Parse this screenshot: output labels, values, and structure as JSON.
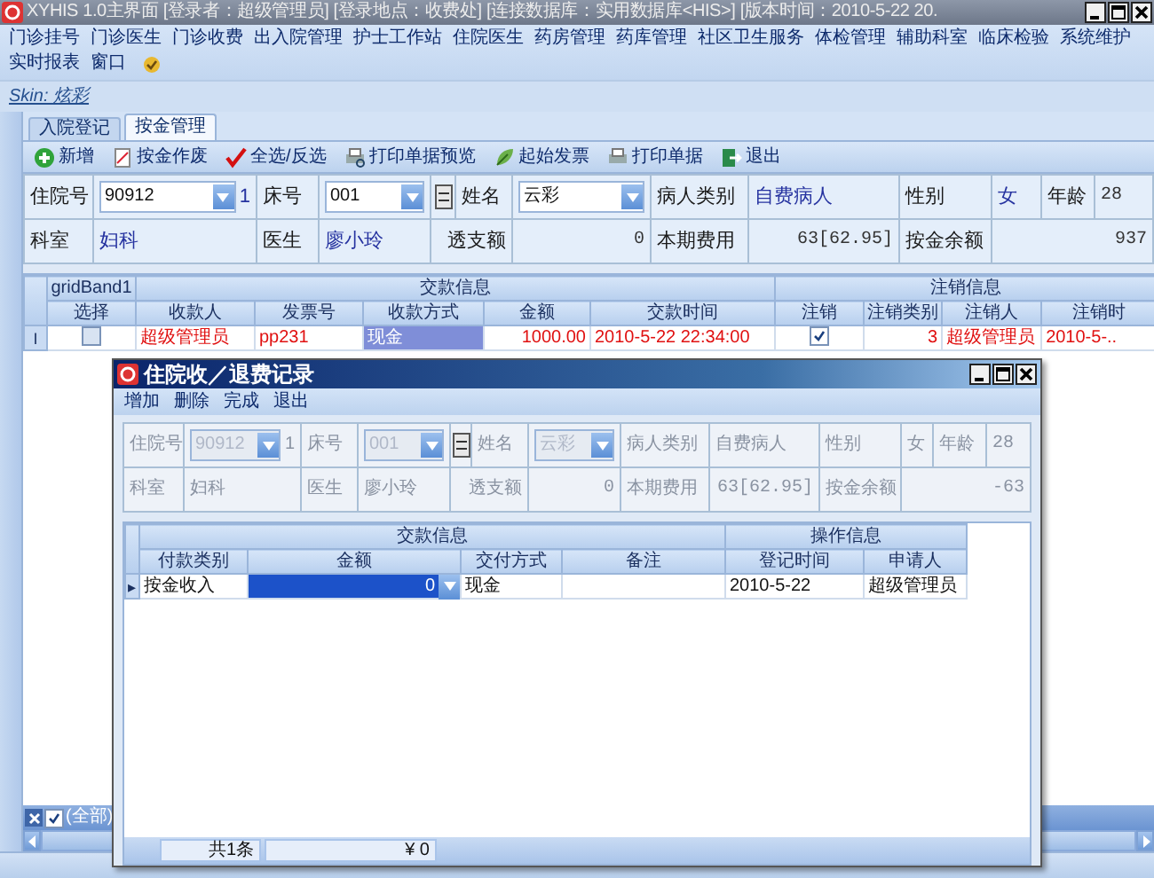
{
  "window": {
    "title": "XYHIS 1.0主界面  [登录者：超级管理员] [登录地点：收费处] [连接数据库：实用数据库<HIS>] [版本时间：2010-5-22 20."
  },
  "menu_rows": [
    [
      "门诊挂号",
      "门诊医生",
      "门诊收费",
      "出入院管理",
      "护士工作站",
      "住院医生",
      "药房管理",
      "药库管理",
      "社区卫生服务",
      "体检管理",
      "辅助科室",
      "临床检验",
      "系统维护"
    ],
    [
      "实时报表",
      "窗口"
    ]
  ],
  "skin_label": "Skin: 炫彩",
  "tabs": [
    {
      "label": "入院登记",
      "selected": false
    },
    {
      "label": "按金管理",
      "selected": true
    }
  ],
  "toolbar": [
    {
      "kind": "add",
      "label": "新增"
    },
    {
      "kind": "void",
      "label": "按金作废"
    },
    {
      "kind": "check",
      "label": "全选/反选"
    },
    {
      "kind": "preview",
      "label": "打印单据预览"
    },
    {
      "kind": "invoice",
      "label": "起始发票"
    },
    {
      "kind": "print",
      "label": "打印单据"
    },
    {
      "kind": "exit",
      "label": "退出"
    }
  ],
  "patient_form": {
    "disabled": false,
    "labels": [
      "住院号",
      "床号",
      "姓名",
      "病人类别",
      "性别",
      "年龄",
      "科室",
      "医生",
      "透支额",
      "本期费用",
      "按金余额"
    ],
    "admission_no": "90912",
    "visit_count": "1",
    "bed_no": "001",
    "name": "云彩",
    "patient_type": "自费病人",
    "sex": "女",
    "age": "28",
    "department": "妇科",
    "doctor": "廖小玲",
    "overdraft": "0",
    "period_cost": "63[62.95]",
    "deposit_balance": "937"
  },
  "grid": {
    "bands": [
      {
        "label": "gridBand1",
        "columns": [
          "选择"
        ]
      },
      {
        "label": "交款信息",
        "columns": [
          "收款人",
          "发票号",
          "收款方式",
          "金额",
          "交款时间"
        ]
      },
      {
        "label": "注销信息",
        "columns": [
          "注销",
          "注销类别",
          "注销人",
          "注销时"
        ]
      }
    ],
    "rows": [
      {
        "indicator": "I",
        "cells": [
          {
            "kind": "check",
            "checked": false
          },
          {
            "kind": "text",
            "text": "超级管理员"
          },
          {
            "kind": "text",
            "text": "pp231"
          },
          {
            "kind": "text",
            "text": "现金",
            "focused": true
          },
          {
            "kind": "number",
            "text": "1000.00"
          },
          {
            "kind": "text",
            "text": "2010-5-22 22:34:00"
          },
          {
            "kind": "check",
            "checked": true
          },
          {
            "kind": "number",
            "text": "3"
          },
          {
            "kind": "text",
            "text": "超级管理员"
          },
          {
            "kind": "text",
            "text": "2010-5-.."
          }
        ]
      }
    ]
  },
  "filter": {
    "label": "(全部)",
    "checked": true
  },
  "dialog": {
    "title": "住院收／退费记录",
    "menu": [
      "增加",
      "删除",
      "完成",
      "退出"
    ],
    "patient_form": {
      "disabled": true,
      "labels": [
        "住院号",
        "床号",
        "姓名",
        "病人类别",
        "性别",
        "年龄",
        "科室",
        "医生",
        "透支额",
        "本期费用",
        "按金余额"
      ],
      "admission_no": "90912",
      "visit_count": "1",
      "bed_no": "001",
      "name": "云彩",
      "patient_type": "自费病人",
      "sex": "女",
      "age": "28",
      "department": "妇科",
      "doctor": "廖小玲",
      "overdraft": "0",
      "period_cost": "63[62.95]",
      "deposit_balance": "-63"
    },
    "grid": {
      "bands": [
        {
          "label": "交款信息",
          "columns": [
            "付款类别",
            "金额",
            "交付方式",
            "备注"
          ]
        },
        {
          "label": "操作信息",
          "columns": [
            "登记时间",
            "申请人"
          ]
        }
      ],
      "rows": [
        {
          "indicator": "▸",
          "cells": [
            {
              "kind": "text",
              "text": "按金收入"
            },
            {
              "kind": "editor",
              "text": "0"
            },
            {
              "kind": "text",
              "text": "现金"
            },
            {
              "kind": "empty"
            },
            {
              "kind": "text",
              "text": "2010-5-22"
            },
            {
              "kind": "text",
              "text": "超级管理员"
            }
          ]
        }
      ]
    },
    "status": [
      "共1条",
      "¥ 0"
    ]
  }
}
